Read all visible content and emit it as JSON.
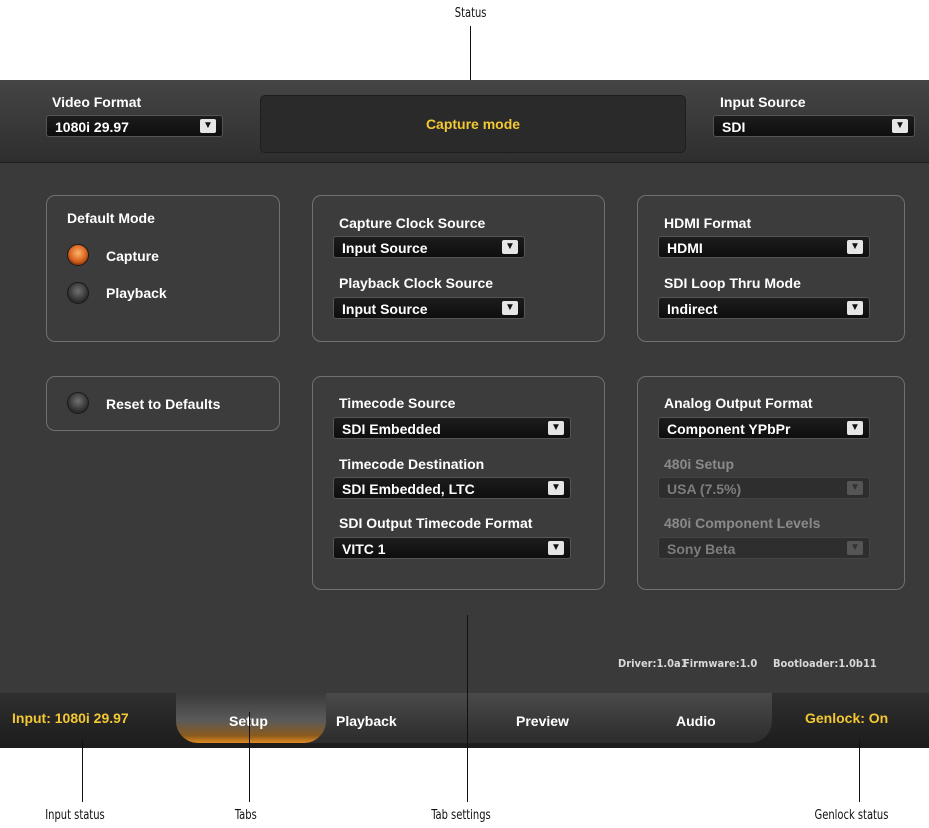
{
  "callouts": {
    "status": "Status",
    "input_status": "Input status",
    "tabs": "Tabs",
    "tab_settings": "Tab settings",
    "genlock_status": "Genlock status"
  },
  "topbar": {
    "video_format_label": "Video Format",
    "video_format_value": "1080i 29.97",
    "status_text": "Capture mode",
    "input_source_label": "Input Source",
    "input_source_value": "SDI"
  },
  "default_mode": {
    "title": "Default Mode",
    "options": [
      {
        "label": "Capture",
        "selected": true
      },
      {
        "label": "Playback",
        "selected": false
      }
    ]
  },
  "reset_label": "Reset to Defaults",
  "clock": {
    "capture_label": "Capture Clock Source",
    "capture_value": "Input Source",
    "playback_label": "Playback Clock Source",
    "playback_value": "Input Source"
  },
  "hdmi": {
    "format_label": "HDMI Format",
    "format_value": "HDMI",
    "loop_label": "SDI Loop Thru Mode",
    "loop_value": "Indirect"
  },
  "timecode": {
    "source_label": "Timecode Source",
    "source_value": "SDI Embedded",
    "dest_label": "Timecode Destination",
    "dest_value": "SDI Embedded, LTC",
    "sdi_out_label": "SDI Output Timecode Format",
    "sdi_out_value": "VITC 1"
  },
  "analog": {
    "format_label": "Analog Output Format",
    "format_value": "Component YPbPr",
    "setup_label": "480i Setup",
    "setup_value": "USA (7.5%)",
    "levels_label": "480i Component Levels",
    "levels_value": "Sony Beta"
  },
  "versions": {
    "driver": "Driver:1.0a1",
    "firmware": "Firmware:1.0",
    "bootloader": "Bootloader:1.0b11"
  },
  "bottombar": {
    "input_status": "Input: 1080i 29.97",
    "genlock_status": "Genlock: On",
    "tabs": [
      "Setup",
      "Playback",
      "Preview",
      "Audio"
    ],
    "active_tab": "Setup"
  },
  "colors": {
    "accent_yellow": "#f3c832",
    "radio_on": "#d5601b",
    "panel_bg": "#3a3a3a"
  }
}
